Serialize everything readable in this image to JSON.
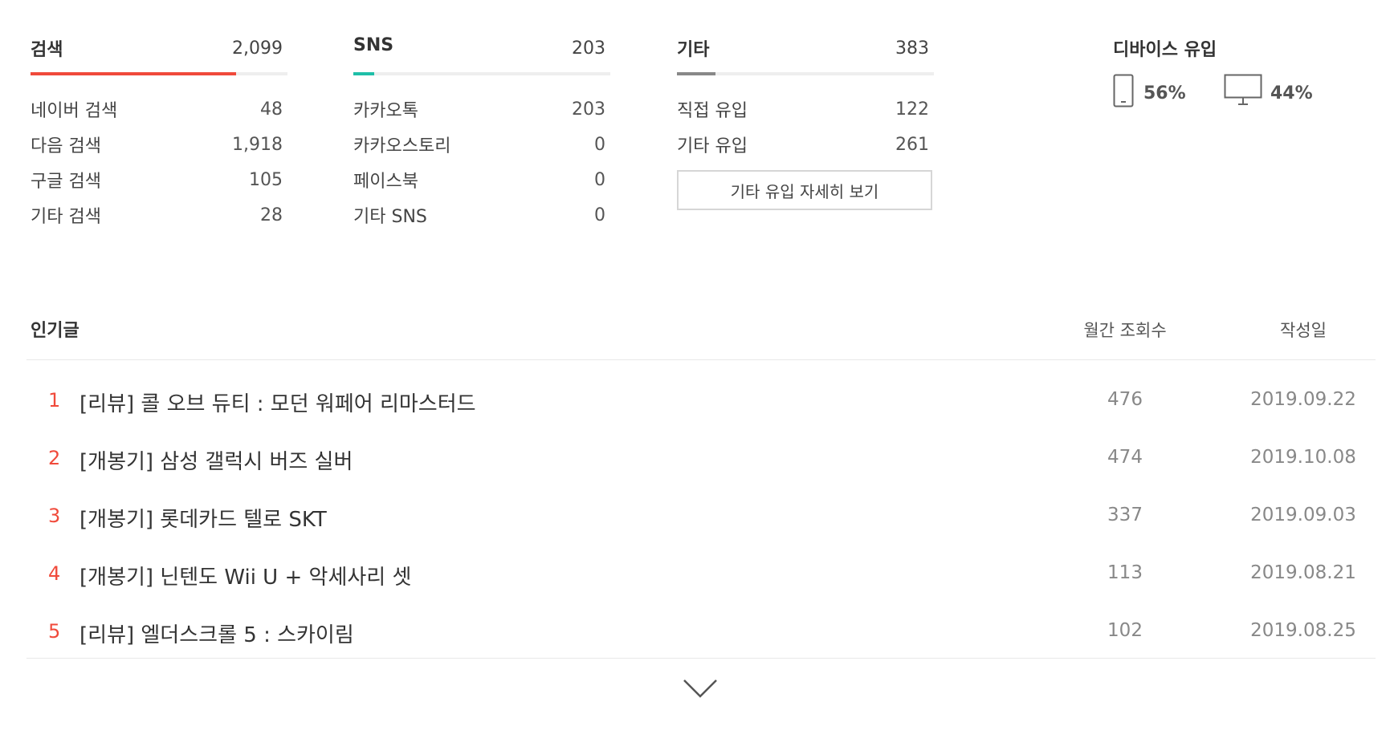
{
  "sources": [
    {
      "title": "검색",
      "total": "2,099",
      "bar_color": "#f04a3b",
      "bar_fraction": 0.8,
      "items": [
        {
          "label": "네이버 검색",
          "value": "48"
        },
        {
          "label": "다음 검색",
          "value": "1,918"
        },
        {
          "label": "구글 검색",
          "value": "105"
        },
        {
          "label": "기타 검색",
          "value": "28"
        }
      ]
    },
    {
      "title": "SNS",
      "total": "203",
      "bar_color": "#1fbfa8",
      "bar_fraction": 0.08,
      "items": [
        {
          "label": "카카오톡",
          "value": "203"
        },
        {
          "label": "카카오스토리",
          "value": "0"
        },
        {
          "label": "페이스북",
          "value": "0"
        },
        {
          "label": "기타 SNS",
          "value": "0"
        }
      ]
    },
    {
      "title": "기타",
      "total": "383",
      "bar_color": "#888888",
      "bar_fraction": 0.15,
      "items": [
        {
          "label": "직접 유입",
          "value": "122"
        },
        {
          "label": "기타 유입",
          "value": "261"
        }
      ],
      "detail_button": "기타 유입 자세히 보기"
    }
  ],
  "device": {
    "title": "디바이스 유입",
    "mobile": {
      "icon": "mobile-phone-icon",
      "percent": "56%"
    },
    "pc": {
      "icon": "desktop-monitor-icon",
      "percent": "44%"
    }
  },
  "popular": {
    "title": "인기글",
    "views_header": "월간 조회수",
    "date_header": "작성일",
    "posts": [
      {
        "rank": "1",
        "title": "[리뷰] 콜 오브 듀티 : 모던 워페어 리마스터드",
        "views": "476",
        "date": "2019.09.22"
      },
      {
        "rank": "2",
        "title": "[개봉기] 삼성 갤럭시 버즈 실버",
        "views": "474",
        "date": "2019.10.08"
      },
      {
        "rank": "3",
        "title": "[개봉기] 롯데카드 텔로 SKT",
        "views": "337",
        "date": "2019.09.03"
      },
      {
        "rank": "4",
        "title": "[개봉기] 닌텐도 Wii U + 악세사리 셋",
        "views": "113",
        "date": "2019.08.21"
      },
      {
        "rank": "5",
        "title": "[리뷰] 엘더스크롤 5 : 스카이림",
        "views": "102",
        "date": "2019.08.25"
      }
    ],
    "more_icon": "chevron-down-icon"
  }
}
